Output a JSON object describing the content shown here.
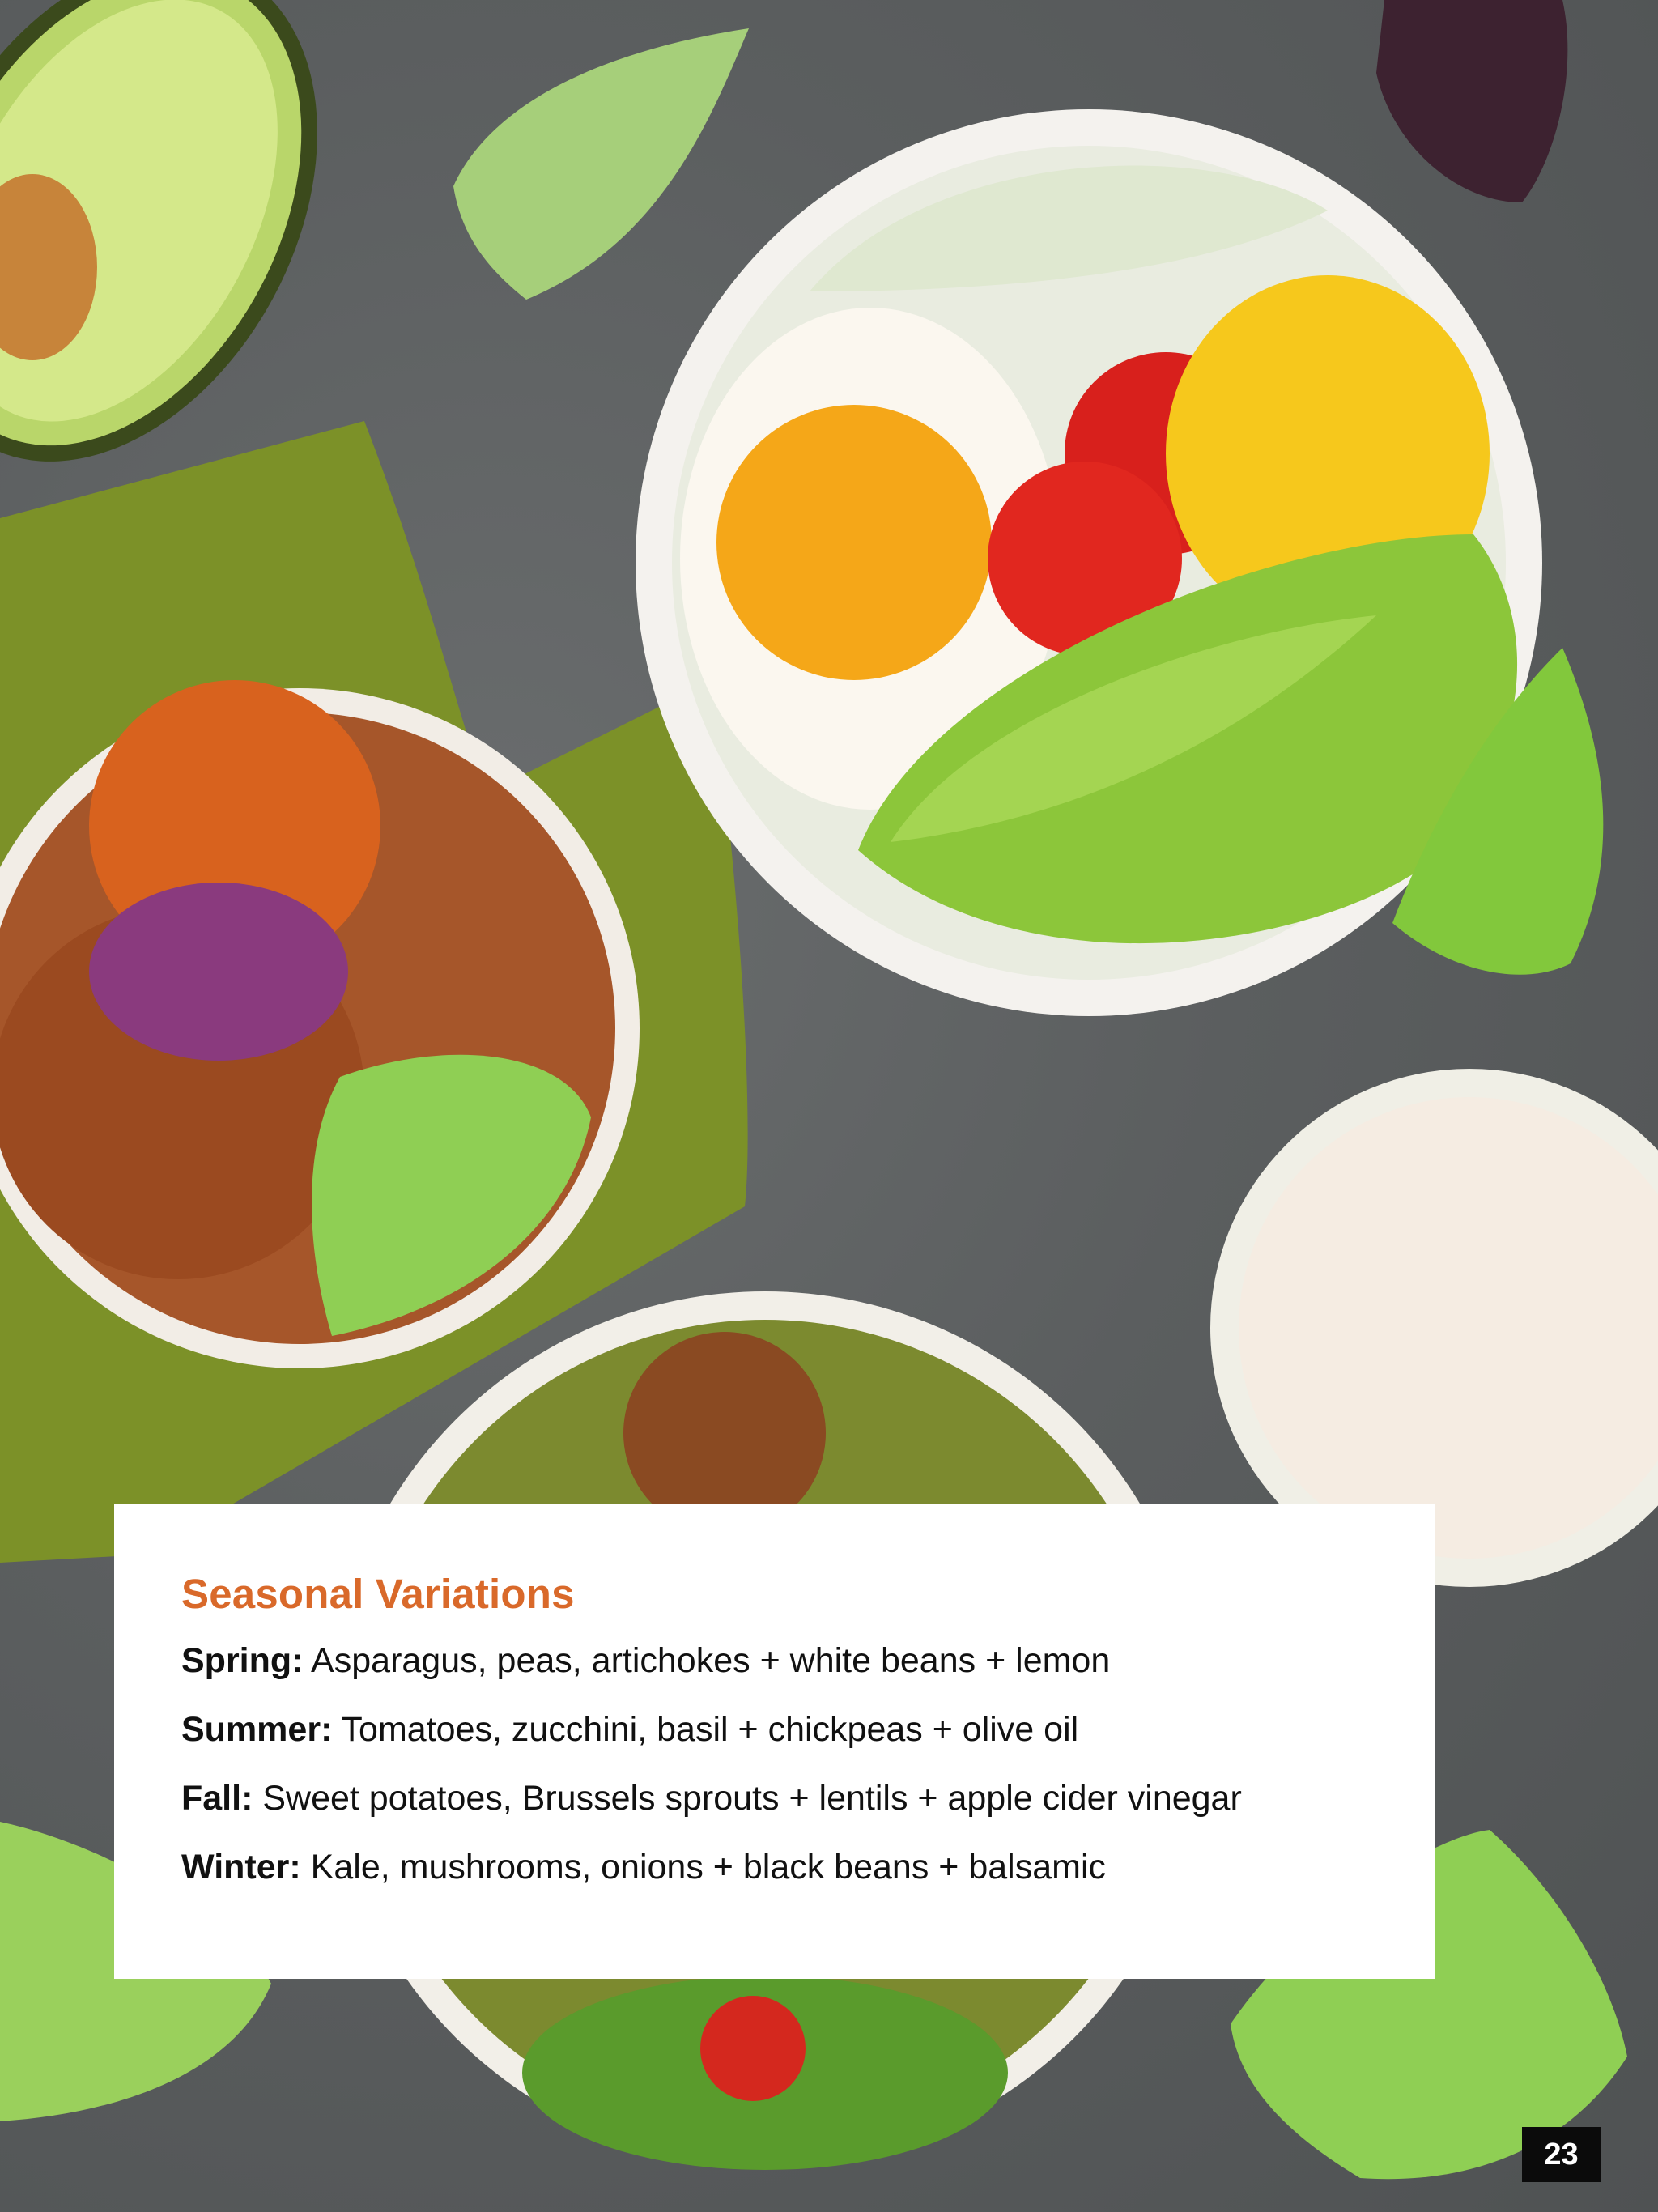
{
  "card": {
    "title": "Seasonal Variations",
    "rows": [
      {
        "season": "Spring:",
        "text": " Asparagus, peas, artichokes + white beans + lemon"
      },
      {
        "season": "Summer:",
        "text": " Tomatoes, zucchini, basil + chickpeas + olive oil"
      },
      {
        "season": "Fall:",
        "text": " Sweet potatoes, Brussels sprouts + lentils + apple cider vinegar"
      },
      {
        "season": "Winter:",
        "text": " Kale, mushrooms, onions + black beans + balsamic"
      }
    ]
  },
  "page_number": "23",
  "colors": {
    "accent": "#d9692a",
    "background": "#5f6263",
    "card": "#ffffff",
    "page_badge": "#0b0b0b"
  }
}
